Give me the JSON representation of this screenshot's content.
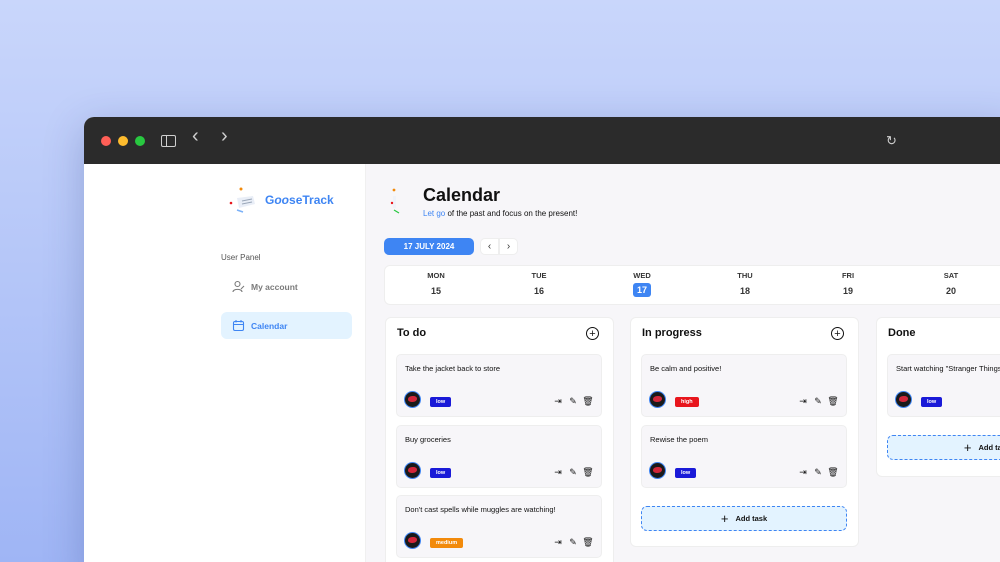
{
  "browser": {
    "back_icon": "‹",
    "forward_icon": "›",
    "reload_icon": "↻"
  },
  "sidebar": {
    "logo_text_a": "G",
    "logo_text_b": "oo",
    "logo_text_c": "seTrack",
    "panel_label": "User Panel",
    "items": [
      {
        "label": "My account",
        "icon": "user-icon"
      },
      {
        "label": "Calendar",
        "icon": "calendar-icon"
      }
    ]
  },
  "header": {
    "title": "Calendar",
    "subtitle_highlight": "Let go",
    "subtitle_rest": " of the past and focus on the present!"
  },
  "toolbar": {
    "date_label": "17 JULY 2024",
    "prev": "‹",
    "next": "›"
  },
  "week": [
    {
      "name": "MON",
      "date": "15"
    },
    {
      "name": "TUE",
      "date": "16"
    },
    {
      "name": "WED",
      "date": "17",
      "active": true
    },
    {
      "name": "THU",
      "date": "18"
    },
    {
      "name": "FRI",
      "date": "19"
    },
    {
      "name": "SAT",
      "date": "20"
    }
  ],
  "columns": {
    "todo": {
      "title": "To do",
      "cards": [
        {
          "text": "Take the jacket back to store",
          "priority": "low"
        },
        {
          "text": "Buy groceries",
          "priority": "low"
        },
        {
          "text": "Don't cast spells while muggles are watching!",
          "priority": "medium"
        }
      ]
    },
    "progress": {
      "title": "In progress",
      "cards": [
        {
          "text": "Be calm and positive!",
          "priority": "high"
        },
        {
          "text": "Rewise the poem",
          "priority": "low"
        }
      ],
      "add_label": "Add task"
    },
    "done": {
      "title": "Done",
      "cards": [
        {
          "text": "Start watching \"Stranger Things\"",
          "priority": "low"
        }
      ],
      "add_label": "Add task"
    }
  },
  "colors": {
    "accent": "#3e85f3",
    "low": "#1a1ad8",
    "high": "#e8161d",
    "medium": "#f28a0b"
  }
}
